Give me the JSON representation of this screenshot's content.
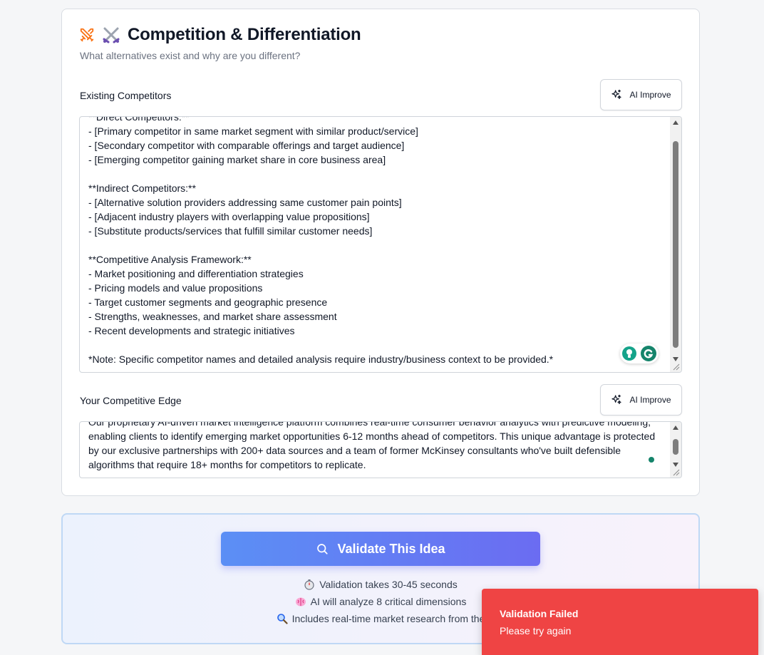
{
  "section": {
    "title": "Competition & Differentiation",
    "subtitle": "What alternatives exist and why are you different?"
  },
  "competitors_field": {
    "label": "Existing Competitors",
    "ai_button": "AI Improve",
    "value": "**Direct Competitors:**\n- [Primary competitor in same market segment with similar product/service]\n- [Secondary competitor with comparable offerings and target audience]\n- [Emerging competitor gaining market share in core business area]\n\n**Indirect Competitors:**\n- [Alternative solution providers addressing same customer pain points]\n- [Adjacent industry players with overlapping value propositions]\n- [Substitute products/services that fulfill similar customer needs]\n\n**Competitive Analysis Framework:**\n- Market positioning and differentiation strategies\n- Pricing models and value propositions\n- Target customer segments and geographic presence\n- Strengths, weaknesses, and market share assessment\n- Recent developments and strategic initiatives\n\n*Note: Specific competitor names and detailed analysis require industry/business context to be provided.*"
  },
  "edge_field": {
    "label": "Your Competitive Edge",
    "ai_button": "AI Improve",
    "value": "Our proprietary AI-driven market intelligence platform combines real-time consumer behavior analytics with predictive modeling, enabling clients to identify emerging market opportunities 6-12 months ahead of competitors. This unique advantage is protected by our exclusive partnerships with 200+ data sources and a team of former McKinsey consultants who've built defensible algorithms that require 18+ months for competitors to replicate."
  },
  "validate": {
    "button_label": "Validate This Idea",
    "info": [
      "Validation takes 30-45 seconds",
      "AI will analyze 8 critical dimensions",
      "Includes real-time market research from the"
    ]
  },
  "toast": {
    "title": "Validation Failed",
    "message": "Please try again"
  },
  "colors": {
    "accent": "#6366f1",
    "toast": "#ef4444",
    "grammarly": "#15846b"
  }
}
